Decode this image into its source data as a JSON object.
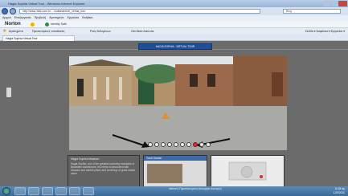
{
  "window": {
    "title": "Hagia Sophia Virtual Tour - Windows Internet Explorer"
  },
  "address_bar": {
    "url": "http://www.3dis.com.tr/..../sultanahmet_virtual_tour",
    "search_placeholder": "Bing"
  },
  "menu": [
    "Αρχείο",
    "Επεξεργασία",
    "Προβολή",
    "Αγαπημένα",
    "Εργαλεία",
    "Βοήθεια"
  ],
  "norton": {
    "logo": "Norton",
    "cards_label": "Identity Safe"
  },
  "favorites": {
    "label": "Αγαπημένα",
    "items": [
      "Προτεινόμενες τοποθεσίες",
      "Ροές δεδομένων",
      "Get More Add-ons"
    ]
  },
  "toolbar_commands": "Σελίδα ▾  Ασφάλεια ▾  Εργαλεία ▾",
  "tab": {
    "label": "Hagia Sophia Virtual Tour"
  },
  "tour": {
    "title": "HAGIA SOPHIA · VIRTUAL TOUR",
    "nav_button_count": 10,
    "info_panel": {
      "title": "Hagia Sophia Museum",
      "body": "Hagia Sophia, one of the greatest surviving examples of Byzantine architecture. Its interior is decorated with mosaics and marble pillars and coverings of great artistic value."
    },
    "photo_panel": {
      "title": "Tomb Garden"
    }
  },
  "taskbar": {
    "status": "Internet | Προστατευμένη λειτουργία: Ανενεργή",
    "time": "11:08 πμ",
    "date": "12/9/2010"
  },
  "colors": {
    "tour_title_bar": "#1d4f9a",
    "active_nav_button": "#d53030"
  }
}
